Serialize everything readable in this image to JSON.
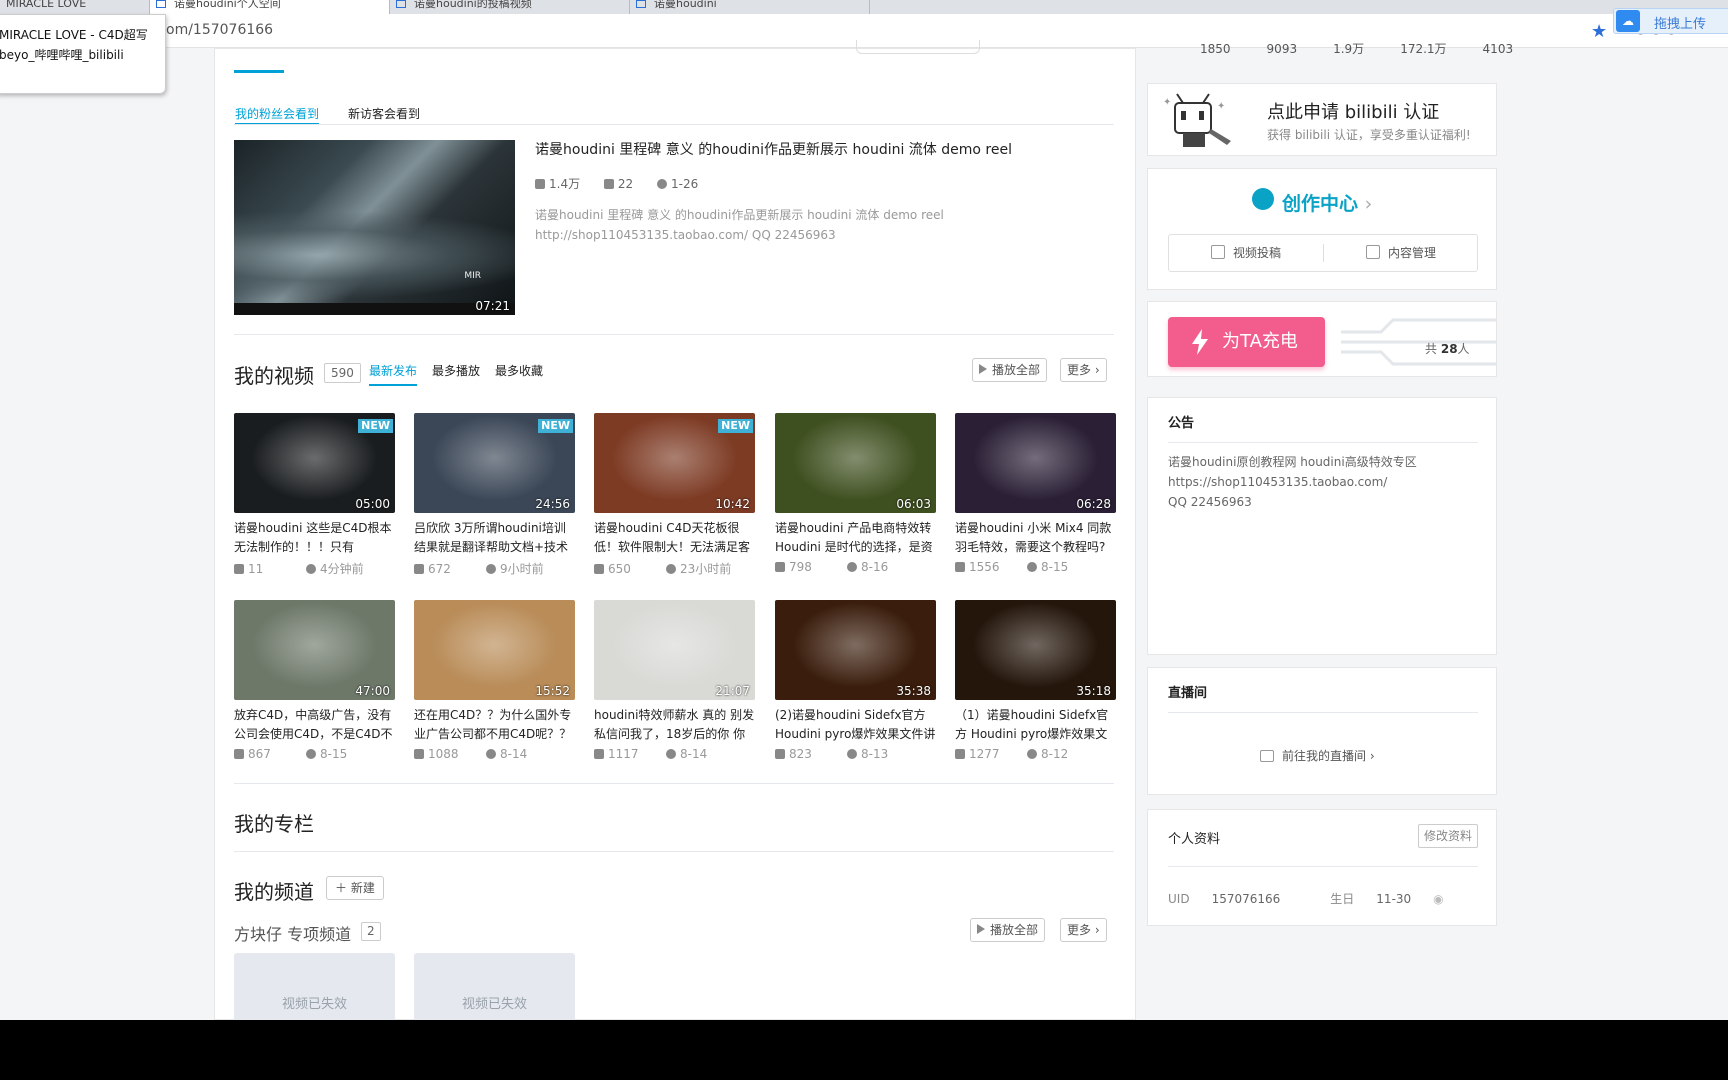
{
  "browser": {
    "tabs": [
      {
        "label": "MIRACLE LOVE"
      },
      {
        "label": "诺曼houdini个人空间"
      },
      {
        "label": "诺曼houdini的投稿视频"
      },
      {
        "label": "诺曼houdini"
      }
    ],
    "url": "om/157076166",
    "tooltip_line1": "MIRACLE LOVE - C4D超写",
    "tooltip_line2": "beyo_哔哩哔哩_bilibili",
    "upload_label": "拖拽上传"
  },
  "top_stats": [
    "1850",
    "9093",
    "1.9万",
    "172.1万",
    "4103"
  ],
  "featured": {
    "tabs": [
      "我的粉丝会看到",
      "新访客会看到"
    ],
    "title": "诺曼houdini 里程碑 意义 的houdini作品更新展示 houdini 流体 demo reel",
    "plays": "1.4万",
    "danmaku": "22",
    "date": "1-26",
    "desc_line1": "诺曼houdini 里程碑 意义 的houdini作品更新展示 houdini 流体 demo reel",
    "desc_line2": "http://shop110453135.taobao.com/ QQ 22456963",
    "duration": "07:21",
    "logo": "MIR"
  },
  "my_videos": {
    "title": "我的视频",
    "count": "590",
    "sort_tabs": [
      "最新发布",
      "最多播放",
      "最多收藏"
    ],
    "play_all": "播放全部",
    "more": "更多",
    "new_badge": "NEW",
    "videos": [
      {
        "title": "诺曼houdini 这些是C4D根本无法制作的！！！只有",
        "duration": "05:00",
        "plays": "11",
        "time": "4分钟前",
        "is_new": true,
        "color": "#1a1d1f"
      },
      {
        "title": "吕欣欣 3万所谓houdini培训结果就是翻译帮助文档+技术",
        "duration": "24:56",
        "plays": "672",
        "time": "9小时前",
        "is_new": true,
        "color": "#3b4757"
      },
      {
        "title": "诺曼houdini C4D天花板很低！软件限制大！无法满足客",
        "duration": "10:42",
        "plays": "650",
        "time": "23小时前",
        "is_new": true,
        "color": "#7d3b24"
      },
      {
        "title": "诺曼houdini 产品电商特效转Houdini 是时代的选择，是资",
        "duration": "06:03",
        "plays": "798",
        "time": "8-16",
        "is_new": false,
        "color": "#3f5020"
      },
      {
        "title": "诺曼houdini 小米 Mix4 同款羽毛特效，需要这个教程吗?",
        "duration": "06:28",
        "plays": "1556",
        "time": "8-15",
        "is_new": false,
        "color": "#2a1f35"
      },
      {
        "title": "放弃C4D，中高级广告，没有公司会使用C4D，不是C4D不",
        "duration": "47:00",
        "plays": "867",
        "time": "8-15",
        "is_new": false,
        "color": "#6d7869"
      },
      {
        "title": "还在用C4D？？为什么国外专业广告公司都不用C4D呢？？",
        "duration": "15:52",
        "plays": "1088",
        "time": "8-14",
        "is_new": false,
        "color": "#b98c58"
      },
      {
        "title": "houdini特效师薪水 真的 别发私信问我了，18岁后的你 你",
        "duration": "21:07",
        "plays": "1117",
        "time": "8-14",
        "is_new": false,
        "color": "#d9d9d6"
      },
      {
        "title": "(2)诺曼houdini Sidefx官方Houdini pyro爆炸效果文件讲",
        "duration": "35:38",
        "plays": "823",
        "time": "8-13",
        "is_new": false,
        "color": "#3a1d0c"
      },
      {
        "title": "（1）诺曼houdini Sidefx官方 Houdini pyro爆炸效果文",
        "duration": "35:18",
        "plays": "1277",
        "time": "8-12",
        "is_new": false,
        "color": "#24160b"
      }
    ]
  },
  "columns": {
    "title": "我的专栏"
  },
  "channels": {
    "title": "我的频道",
    "new_label": "新建",
    "sub_name": "方块仔 专项频道",
    "sub_count": "2",
    "play_all": "播放全部",
    "more": "更多",
    "invalid_label": "视频已失效"
  },
  "sidebar": {
    "cert_title": "点此申请 bilibili 认证",
    "cert_sub": "获得 bilibili 认证，享受多重认证福利!",
    "create_title": "创作中心",
    "upload_btn": "视频投稿",
    "manage_btn": "内容管理",
    "charge_btn": "为TA充电",
    "charge_total_prefix": "共",
    "charge_total_num": "28",
    "charge_total_suffix": "人",
    "notice_title": "公告",
    "notice_lines": [
      "诺曼houdini原创教程网  houdini高级特效专区",
      "https://shop110453135.taobao.com/",
      "QQ  22456963"
    ],
    "live_title": "直播间",
    "live_link": "前往我的直播间",
    "profile_title": "个人资料",
    "edit_btn": "修改资料",
    "uid_label": "UID",
    "uid": "157076166",
    "birthday_label": "生日",
    "birthday": "11-30"
  },
  "colors": {
    "accent": "#00a1d6",
    "charge": "#f25d8e",
    "create": "#0aa3c6"
  }
}
